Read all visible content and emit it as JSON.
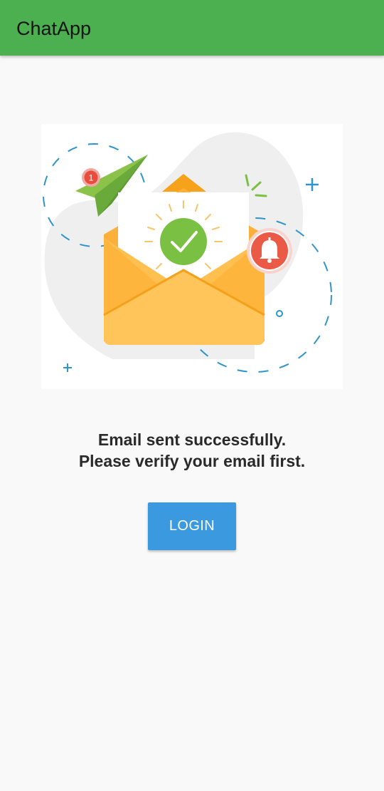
{
  "app_bar": {
    "title": "ChatApp",
    "color": "#4caf50"
  },
  "illustration": {
    "icons": [
      "paper-plane-icon",
      "envelope-icon",
      "checkmark-icon",
      "bell-icon"
    ],
    "badge_count": "1"
  },
  "message": {
    "line1": "Email sent successfully.",
    "line2": "Please verify your email first."
  },
  "login_button": {
    "label": "LOGIN",
    "color": "#3b99e0"
  }
}
